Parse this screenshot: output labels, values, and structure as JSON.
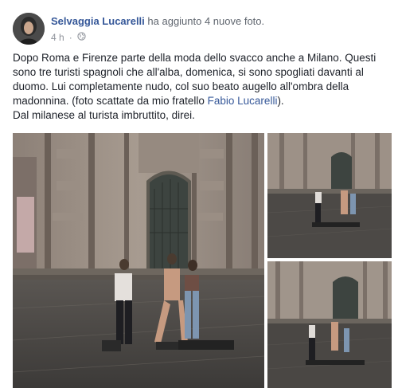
{
  "post": {
    "author_name": "Selvaggia Lucarelli",
    "action_text": "ha aggiunto 4 nuove foto.",
    "timestamp": "4 h",
    "separator": "·",
    "privacy_icon": "globe-icon",
    "text_lines": [
      "Dopo Roma e Firenze parte della moda dello svacco anche a Milano. Questi",
      "sono tre turisti spagnoli che all'alba, domenica, si sono spogliati davanti al",
      "duomo. Lui completamente nudo, col suo beato augello all'ombra della",
      "madonnina. (foto scattate da mio fratello "
    ],
    "tagged_person": "Fabio Lucarelli",
    "tag_suffix": ").",
    "last_line": "Dal milanese al turista imbruttito, direi."
  },
  "colors": {
    "link": "#365899",
    "meta": "#90949c",
    "text": "#1d2129"
  }
}
